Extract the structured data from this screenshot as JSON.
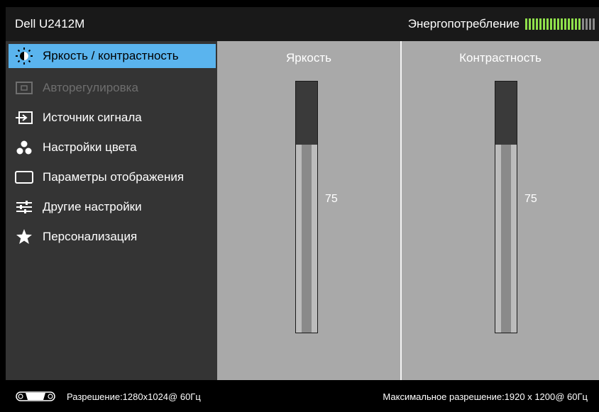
{
  "header": {
    "title": "Dell U2412M",
    "energy_label": "Энергопотребление",
    "energy_level": 0.8
  },
  "menu": {
    "items": [
      {
        "label": "Яркость / контрастность",
        "icon": "brightness-icon",
        "state": "selected"
      },
      {
        "label": "Авторегулировка",
        "icon": "auto-adjust-icon",
        "state": "disabled"
      },
      {
        "label": "Источник сигнала",
        "icon": "input-source-icon",
        "state": "normal"
      },
      {
        "label": "Настройки цвета",
        "icon": "color-settings-icon",
        "state": "normal"
      },
      {
        "label": "Параметры отображения",
        "icon": "display-settings-icon",
        "state": "normal"
      },
      {
        "label": "Другие настройки",
        "icon": "other-settings-icon",
        "state": "normal"
      },
      {
        "label": "Персонализация",
        "icon": "star-icon",
        "state": "normal"
      }
    ]
  },
  "sliders": {
    "brightness": {
      "label": "Яркость",
      "value": "75",
      "level": 0.75
    },
    "contrast": {
      "label": "Контрастность",
      "value": "75",
      "level": 0.75
    }
  },
  "footer": {
    "resolution": "Разрешение:1280x1024@ 60Гц",
    "max_resolution": "Максимальное разрешение:1920 x 1200@ 60Гц"
  },
  "colors": {
    "accent": "#5ab4ee",
    "energy_on": "#8fe04b"
  }
}
